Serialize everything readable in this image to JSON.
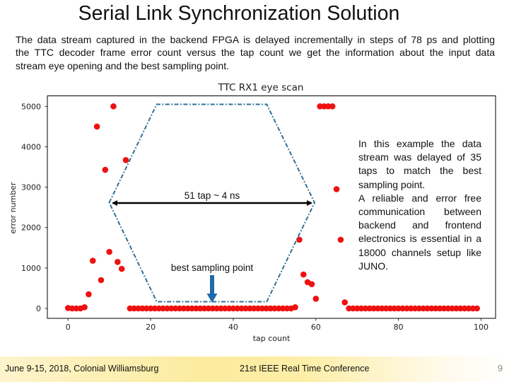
{
  "slide": {
    "title": "Serial Link Synchronization Solution",
    "intro_lines": [
      "The data stream captured in the backend FPGA is delayed incrementally in steps of 78 ps and plotting",
      "the TTC decoder frame error count versus the tap count we get the information about the input data",
      "stream eye opening and the best sampling point."
    ],
    "side_note_lines": [
      "In this example the data",
      "stream was delayed of 35",
      "taps to match the best",
      "sampling point.",
      "A reliable and error free",
      "communication between",
      "backend and frontend",
      "electronics is essential in a",
      "18000 channels setup like",
      "JUNO."
    ],
    "annotations": {
      "eye_width": "51 tap ~ 4 ns",
      "best_point": "best sampling point"
    },
    "footer": {
      "date_location": "June 9-15, 2018, Colonial Williamsburg",
      "conference": "21st IEEE Real Time Conference",
      "page_number": "9"
    }
  },
  "colors": {
    "point": "#ee1111",
    "eye_outline": "#2f6f97",
    "best_point_arrow": "#1f6aab",
    "eye_width_arrow": "#000000",
    "page_number": "#8c8c8c"
  },
  "chart_data": {
    "type": "scatter",
    "title": "TTC RX1 eye scan",
    "xlabel": "tap count",
    "ylabel": "error number",
    "xlim": [
      -5,
      103.5
    ],
    "ylim": [
      -245,
      5260
    ],
    "xticks": [
      0,
      20,
      40,
      60,
      80,
      100
    ],
    "yticks": [
      0,
      1000,
      2000,
      3000,
      4000,
      5000
    ],
    "grid": false,
    "legend": "none",
    "series": [
      {
        "name": "frame error count",
        "x": [
          0,
          1,
          2,
          3,
          4,
          5,
          6,
          7,
          8,
          9,
          10,
          11,
          12,
          13,
          14,
          15,
          16,
          17,
          18,
          19,
          20,
          21,
          22,
          23,
          24,
          25,
          26,
          27,
          28,
          29,
          30,
          31,
          32,
          33,
          34,
          35,
          36,
          37,
          38,
          39,
          40,
          41,
          42,
          43,
          44,
          45,
          46,
          47,
          48,
          49,
          50,
          51,
          52,
          53,
          54,
          55,
          56,
          57,
          58,
          59,
          60,
          61,
          62,
          63,
          64,
          65,
          66,
          67,
          68,
          69,
          70,
          71,
          72,
          73,
          74,
          75,
          76,
          77,
          78,
          79,
          80,
          81,
          82,
          83,
          84,
          85,
          86,
          87,
          88,
          89,
          90,
          91,
          92,
          93,
          94,
          95,
          96,
          97,
          98,
          99
        ],
        "y": [
          10,
          0,
          0,
          0,
          30,
          350,
          1180,
          4500,
          700,
          3430,
          1400,
          5000,
          1150,
          980,
          3670,
          0,
          0,
          0,
          0,
          0,
          0,
          0,
          0,
          0,
          0,
          0,
          0,
          0,
          0,
          0,
          0,
          0,
          0,
          0,
          0,
          0,
          0,
          0,
          0,
          0,
          0,
          0,
          0,
          0,
          0,
          0,
          0,
          0,
          0,
          0,
          0,
          0,
          0,
          0,
          0,
          30,
          1700,
          840,
          650,
          600,
          240,
          5000,
          5000,
          5000,
          5000,
          2950,
          1700,
          150,
          0,
          0,
          0,
          0,
          0,
          0,
          0,
          0,
          0,
          0,
          0,
          0,
          0,
          0,
          0,
          0,
          0,
          0,
          0,
          0,
          0,
          0,
          0,
          0,
          0,
          0,
          0,
          0,
          0,
          0,
          0,
          0
        ]
      }
    ],
    "annotations": {
      "eye_width_taps": 51,
      "eye_width_time": "~4 ns",
      "best_sampling_tap": 35
    }
  }
}
